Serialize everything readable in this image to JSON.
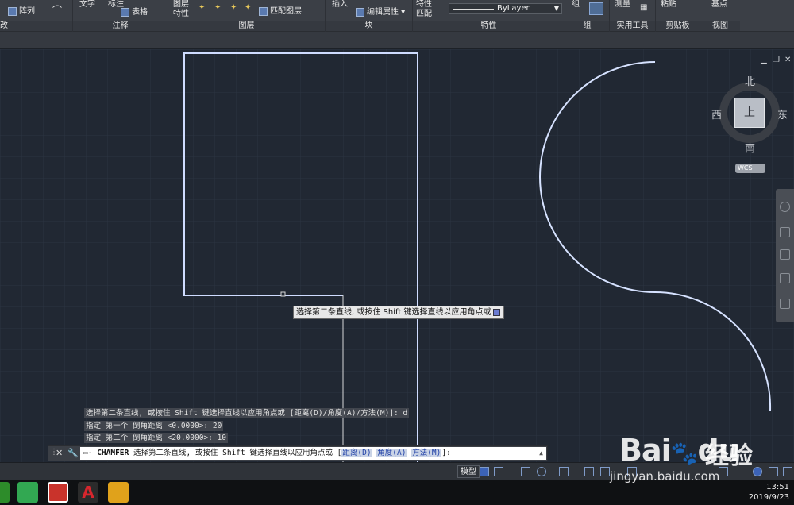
{
  "ribbon": {
    "items": {
      "array": "阵列",
      "text": "文字",
      "dimension": "标注",
      "table": "表格",
      "layer_props": "图层",
      "layer_props2": "特性",
      "match_layer": "匹配图层",
      "insert": "插入",
      "edit_attr": "编辑属性",
      "match_props": "特性",
      "match_props2": "匹配",
      "bylayer": "ByLayer",
      "group": "组",
      "measure": "测量",
      "paste": "粘贴",
      "base": "基点"
    },
    "panels": {
      "modify": "改",
      "annotation": "注释",
      "layers": "图层",
      "block": "块",
      "properties": "特性",
      "groups": "组",
      "utilities": "实用工具",
      "clipboard": "剪贴板",
      "view": "视图"
    }
  },
  "viewcube": {
    "north": "北",
    "south": "南",
    "east": "东",
    "west": "西",
    "top": "上",
    "wcs": "WCS"
  },
  "tooltip": {
    "text": "选择第二条直线, 或按住 Shift 键选择直线以应用角点或"
  },
  "history": [
    "选择第二条直线, 或按住 Shift 键选择直线以应用角点或 [距离(D)/角度(A)/方法(M)]: d",
    "指定 第一个 倒角距离 <0.0000>: 20",
    "指定 第二个 倒角距离 <20.0000>: 10"
  ],
  "command": {
    "name": "CHAMFER",
    "prompt": "选择第二条直线, 或按住 Shift 键选择直线以应用角点或 [",
    "opt_distance": "距离(D)",
    "opt_angle": "角度(A)",
    "opt_method": "方法(M)",
    "suffix": "]:"
  },
  "status": {
    "model": "模型"
  },
  "clock": {
    "time": "13:51",
    "date": "2019/9/23"
  },
  "watermark": {
    "brand": "Bai",
    "paw": "du",
    "jingyan": "经验",
    "url": "jingyan.baidu.com"
  },
  "colors": {
    "canvas": "#212833",
    "curve": "#d6e2ff",
    "ribbon": "#3b3f46"
  }
}
